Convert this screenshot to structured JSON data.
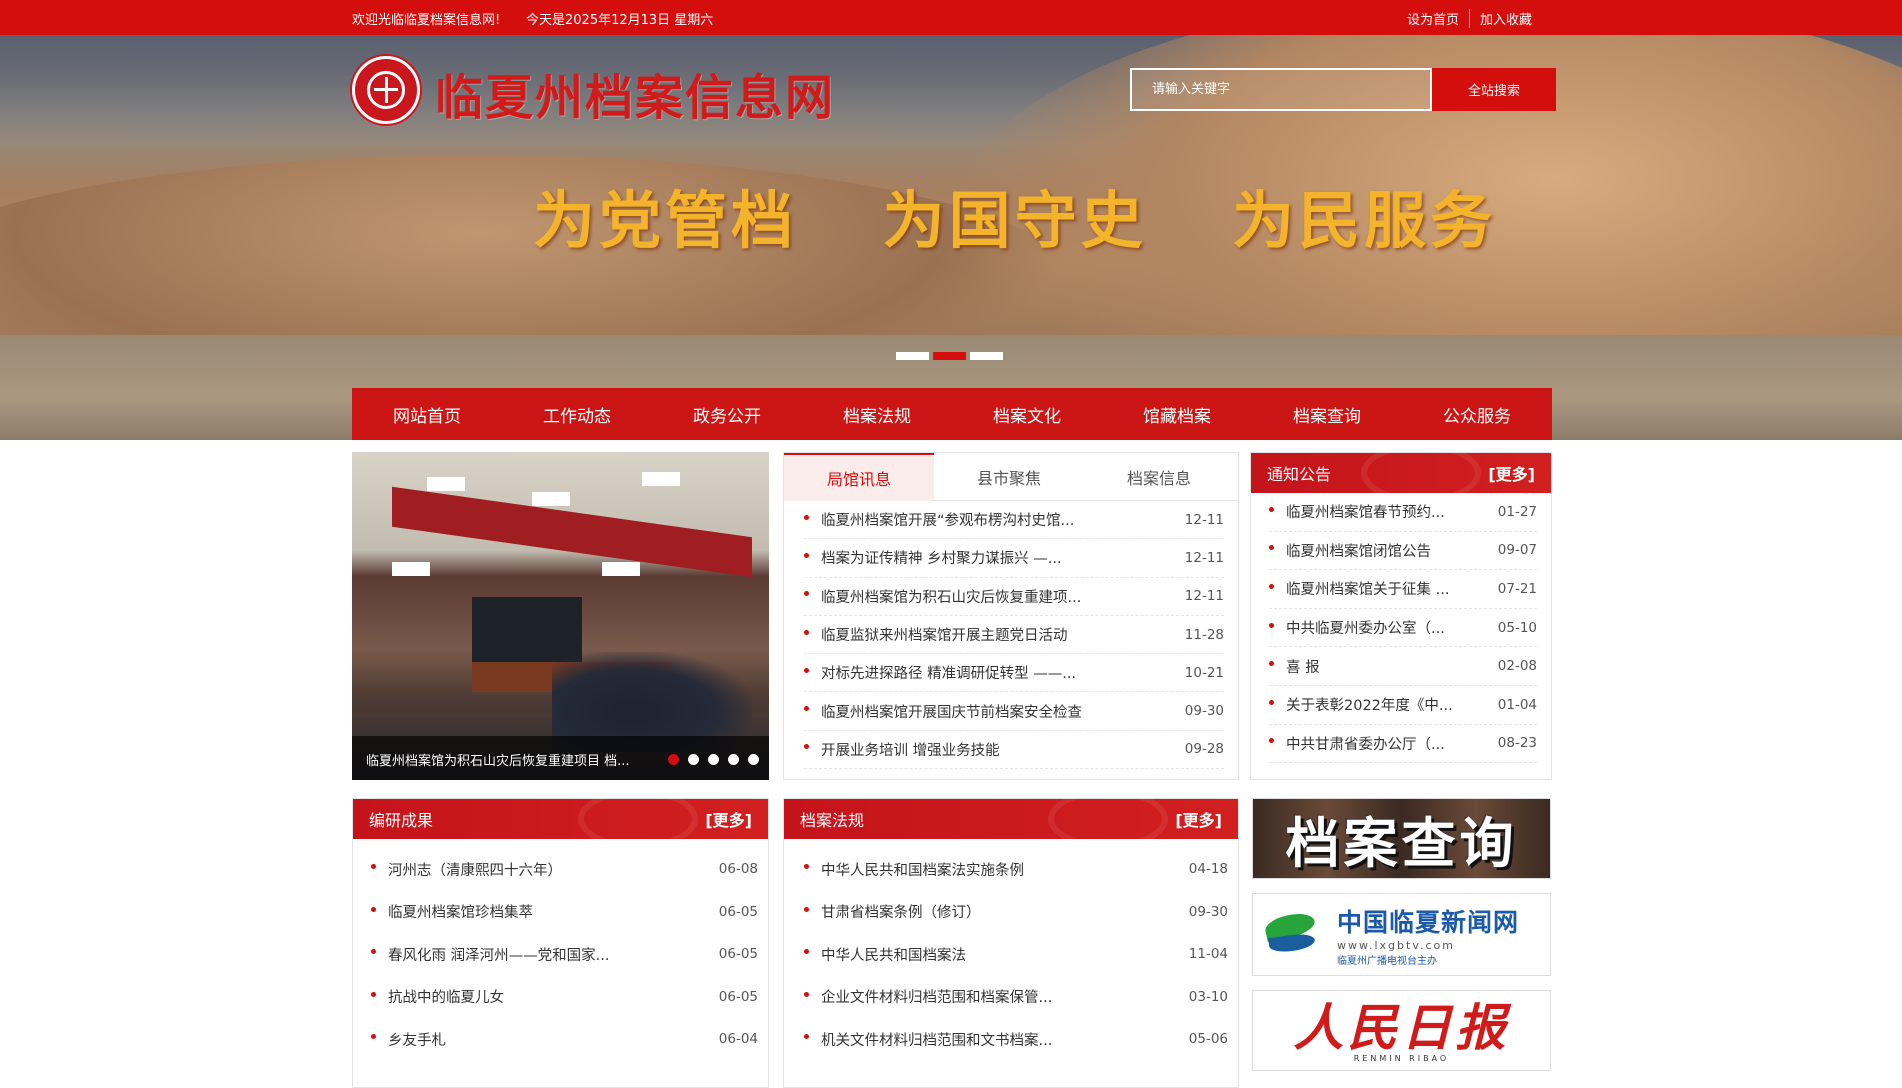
{
  "topbar": {
    "welcome": "欢迎光临临夏档案信息网!",
    "date": "今天是2025年12月13日 星期六",
    "set_home": "设为首页",
    "add_fav": "加入收藏"
  },
  "header": {
    "site_title": "临夏州档案信息网",
    "search_placeholder": "请输入关键字",
    "search_button": "全站搜索",
    "slogan": "为党管档 为国守史 为民服务",
    "logo_icon": "archives-seal-icon"
  },
  "nav": [
    "网站首页",
    "工作动态",
    "政务公开",
    "档案法规",
    "档案文化",
    "馆藏档案",
    "档案查询",
    "公众服务"
  ],
  "slideshow": {
    "caption": "临夏州档案馆为积石山灾后恢复重建项目 档..."
  },
  "news_tabs": {
    "tabs": [
      "局馆讯息",
      "县市聚焦",
      "档案信息"
    ],
    "items": [
      {
        "title": "临夏州档案馆开展“参观布楞沟村史馆...",
        "date": "12-11"
      },
      {
        "title": "档案为证传精神 乡村聚力谋振兴 —...",
        "date": "12-11"
      },
      {
        "title": "临夏州档案馆为积石山灾后恢复重建项...",
        "date": "12-11"
      },
      {
        "title": "临夏监狱来州档案馆开展主题党日活动",
        "date": "11-28"
      },
      {
        "title": "对标先进探路径 精准调研促转型 ——...",
        "date": "10-21"
      },
      {
        "title": "临夏州档案馆开展国庆节前档案安全检查",
        "date": "09-30"
      },
      {
        "title": "开展业务培训 增强业务技能",
        "date": "09-28"
      }
    ]
  },
  "notice": {
    "title": "通知公告",
    "more": "[更多]",
    "items": [
      {
        "title": "临夏州档案馆春节预约...",
        "date": "01-27"
      },
      {
        "title": "临夏州档案馆闭馆公告",
        "date": "09-07"
      },
      {
        "title": "临夏州档案馆关于征集 ...",
        "date": "07-21"
      },
      {
        "title": "中共临夏州委办公室（...",
        "date": "05-10"
      },
      {
        "title": "喜 报",
        "date": "02-08"
      },
      {
        "title": "关于表彰2022年度《中...",
        "date": "01-04"
      },
      {
        "title": "中共甘肃省委办公厅（...",
        "date": "08-23"
      }
    ]
  },
  "bianyan": {
    "title": "编研成果",
    "more": "[更多]",
    "items": [
      {
        "title": "河州志（清康熙四十六年）",
        "date": "06-08"
      },
      {
        "title": "临夏州档案馆珍档集萃",
        "date": "06-05"
      },
      {
        "title": "春风化雨 润泽河州——党和国家...",
        "date": "06-05"
      },
      {
        "title": "抗战中的临夏儿女",
        "date": "06-05"
      },
      {
        "title": "乡友手札",
        "date": "06-04"
      }
    ]
  },
  "fagui": {
    "title": "档案法规",
    "more": "[更多]",
    "items": [
      {
        "title": "中华人民共和国档案法实施条例",
        "date": "04-18"
      },
      {
        "title": "甘肃省档案条例（修订）",
        "date": "09-30"
      },
      {
        "title": "中华人民共和国档案法",
        "date": "11-04"
      },
      {
        "title": "企业文件材料归档范围和档案保管...",
        "date": "03-10"
      },
      {
        "title": "机关文件材料归档范围和文书档案...",
        "date": "05-06"
      }
    ]
  },
  "ads": {
    "archive_query": "档案查询",
    "linxia_news": "中国临夏新闻网",
    "linxia_url": "www.lxgbtv.com",
    "linxia_sub": "临夏州广播电视台主办",
    "peoples_daily": "人民日报",
    "peoples_daily_pinyin": "RENMIN RIBAO"
  }
}
